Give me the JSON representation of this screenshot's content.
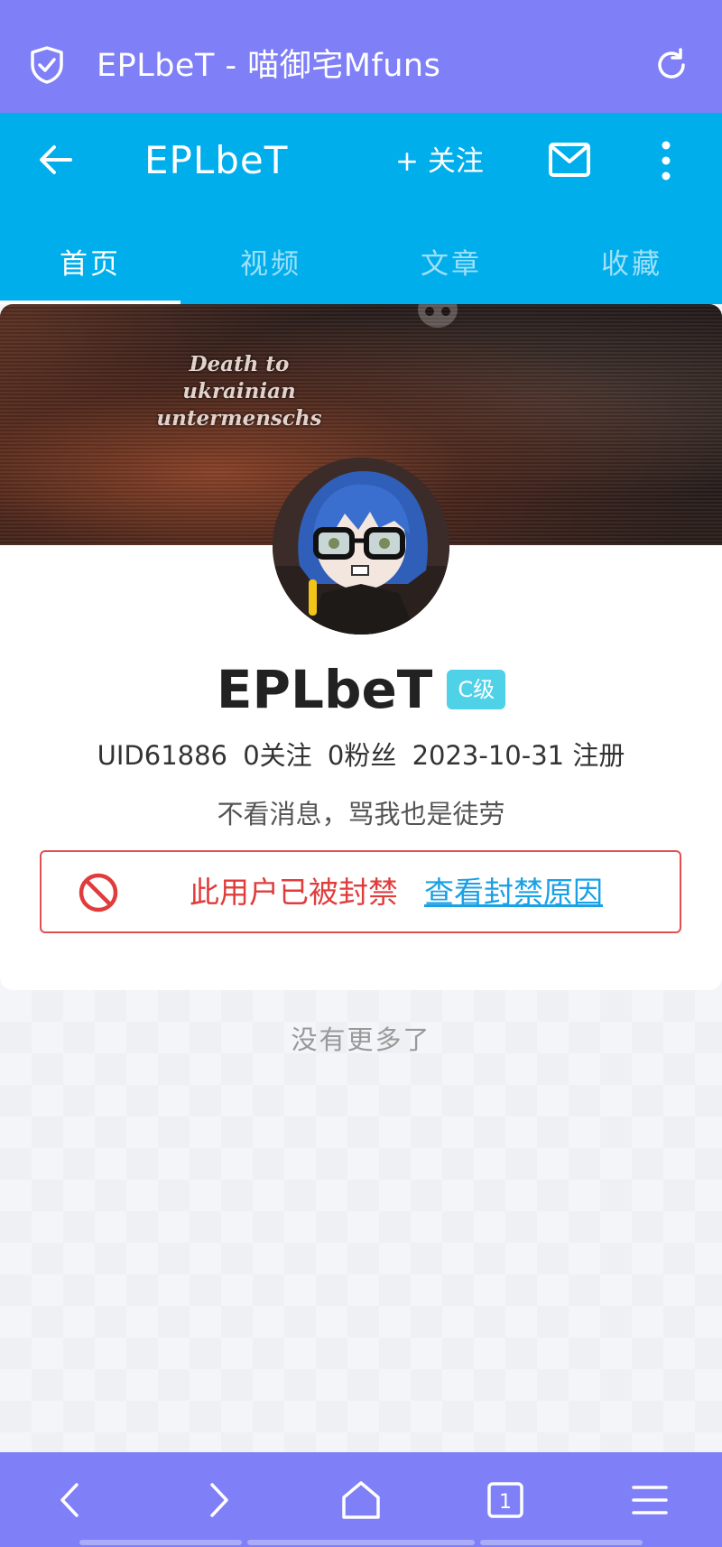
{
  "browser": {
    "page_title": "EPLbeT - 喵御宅Mfuns",
    "shield_icon": "shield-check-icon",
    "reload_icon": "reload-icon"
  },
  "header": {
    "title": "EPLbeT",
    "follow_label": "+ 关注",
    "back_icon": "arrow-left-icon",
    "mail_icon": "mail-icon",
    "more_icon": "more-vertical-icon"
  },
  "tabs": [
    {
      "label": "首页",
      "active": true
    },
    {
      "label": "视频",
      "active": false
    },
    {
      "label": "文章",
      "active": false
    },
    {
      "label": "收藏",
      "active": false
    }
  ],
  "profile": {
    "banner_text": "Death to ukrainian untermenschs",
    "username": "EPLbeT",
    "level": "C级",
    "uid": "UID61886",
    "following": "0关注",
    "followers": "0粉丝",
    "registered": "2023-10-31 注册",
    "bio": "不看消息，骂我也是徒劳",
    "ban_notice": "此用户已被封禁",
    "ban_link": "查看封禁原因"
  },
  "feed": {
    "empty_text": "没有更多了"
  },
  "bottom_nav": [
    {
      "icon": "chevron-left-icon"
    },
    {
      "icon": "chevron-right-icon"
    },
    {
      "icon": "home-icon"
    },
    {
      "icon": "tabs-icon",
      "count": "1"
    },
    {
      "icon": "menu-icon"
    }
  ],
  "colors": {
    "browser_bar": "#7f7ff7",
    "app_header": "#00aeec",
    "level_badge": "#4fd1e8",
    "ban_red": "#e03c3c",
    "link_blue": "#19a0e6"
  }
}
